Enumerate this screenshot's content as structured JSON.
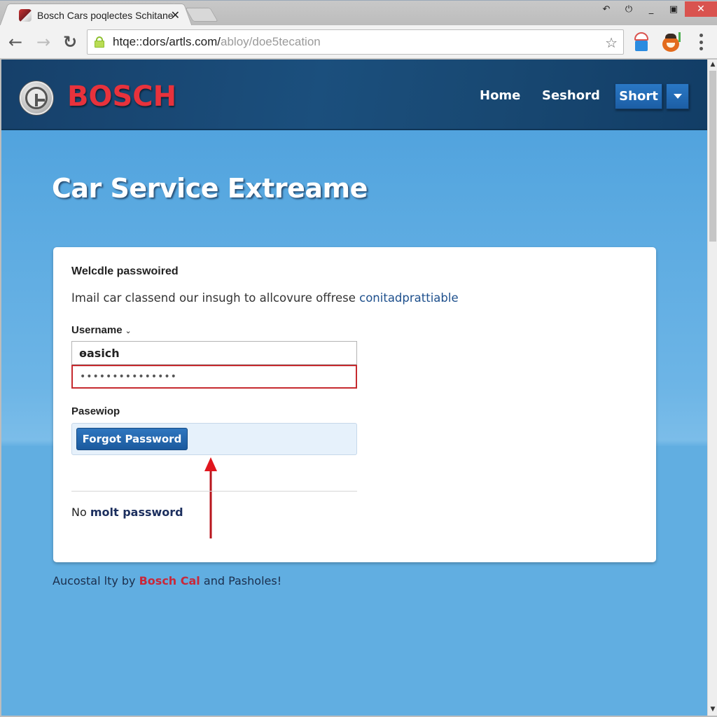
{
  "browser": {
    "tab_title": "Bosch Cars poqlectes Schitane",
    "tab_close": "✕",
    "url_host": "htqe::dors/artls.com/",
    "url_path": "abloy/doe5tecation",
    "back_icon": "←",
    "forward_icon": "→",
    "reload_icon": "↻",
    "star_icon": "☆",
    "window_controls": {
      "extra1": "↶",
      "extra2": "⏻",
      "minimize": "_",
      "maximize": "▣",
      "close": "✕"
    }
  },
  "site": {
    "brand": "BOSCH",
    "nav": {
      "home": "Home",
      "search": "Seshord",
      "button": "Short"
    },
    "hero_title": "Car Service Extreame",
    "card": {
      "heading": "Welcdle passwoired",
      "description": "Imail car classend our insugh to allcovure offrese ",
      "description_link": "conitadprattiable",
      "username_label": "Username",
      "username_chevron": "⌄",
      "username_value": "ɵasich",
      "password_value": "•••••••••••••••",
      "password_label": "Pasewiop",
      "forgot_button": "Forgot Password",
      "no_pw_prefix": "No ",
      "no_pw_link": "molt password"
    },
    "footer": {
      "prefix": "Aucostal lty by ",
      "brand": "Bosch Cal",
      "suffix": " and Pasholes!"
    }
  },
  "colors": {
    "brand_red": "#e8323c",
    "header_navy": "#1b4f7d",
    "page_blue": "#61aee1",
    "button_blue": "#1c5ea5",
    "error_red": "#c62b2f",
    "annotation_arrow": "#c4161c"
  },
  "scrollbar": {
    "up": "▲",
    "down": "▼"
  }
}
